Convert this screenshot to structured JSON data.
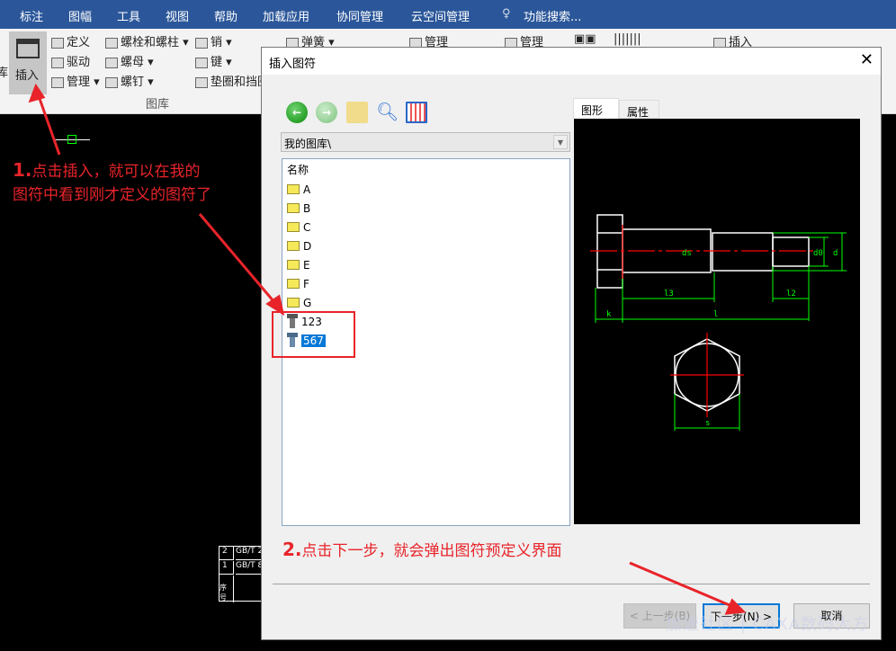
{
  "menubar": {
    "items": [
      "标注",
      "图幅",
      "工具",
      "视图",
      "帮助",
      "加载应用",
      "协同管理",
      "云空间管理"
    ],
    "search": "功能搜索..."
  },
  "ribbon": {
    "insert": "插入",
    "ku": "库",
    "define": "定义",
    "drive": "驱动",
    "manage": "管理",
    "bolt": "螺栓和螺柱",
    "nut": "螺母",
    "screw": "螺钉",
    "pin": "销",
    "key": "键",
    "washer": "垫圈和挡圈",
    "spring": "弹簧",
    "group_label": "图库",
    "manage2": "管理",
    "manage3": "管理",
    "insert2": "插入"
  },
  "annotations": {
    "step1_num": "1.",
    "step1": "点击插入，就可以在我的",
    "step1_line2": "图符中看到刚才定义的图符了",
    "step2_num": "2.",
    "step2": "点击下一步，就会弹出图符预定义界面"
  },
  "dialog": {
    "title": "插入图符",
    "path": "我的图库\\",
    "list_header": "名称",
    "items": [
      {
        "label": "A",
        "type": "folder"
      },
      {
        "label": "B",
        "type": "folder"
      },
      {
        "label": "C",
        "type": "folder"
      },
      {
        "label": "D",
        "type": "folder"
      },
      {
        "label": "E",
        "type": "folder"
      },
      {
        "label": "F",
        "type": "folder"
      },
      {
        "label": "G",
        "type": "folder"
      },
      {
        "label": "123",
        "type": "symbol"
      },
      {
        "label": "567",
        "type": "symbol",
        "selected": true
      }
    ],
    "tabs": [
      "图形",
      "属性"
    ],
    "active_tab": "图形",
    "preview_dims": {
      "l3": "l3",
      "l2": "l2",
      "k": "k",
      "l": "l",
      "s": "s",
      "d": "d",
      "d0": "d0",
      "ds": "ds"
    },
    "back": "< 上一步(B)",
    "next": "下一步(N) >",
    "cancel": "取消"
  },
  "canvas": {
    "table_rows": [
      [
        "2",
        "GB/T 2"
      ],
      [
        "1",
        "GB/T 8"
      ],
      [
        "序号",
        ""
      ]
    ]
  },
  "watermark": "加速社区 | CAXA数码大方",
  "colors": {
    "menubar": "#2b579a",
    "accent": "#0078d7",
    "annotation": "#e8242a",
    "dim": "#00ff00",
    "center": "#ff0000"
  }
}
